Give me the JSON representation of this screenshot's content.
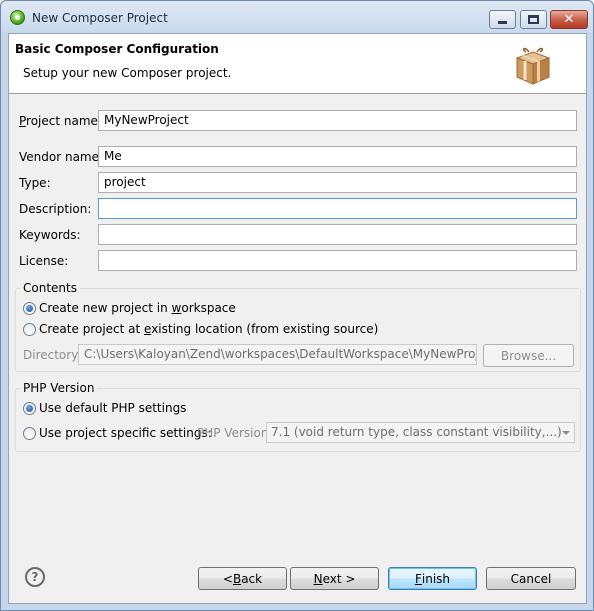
{
  "window": {
    "title": "New Composer Project",
    "min_glyph": "–",
    "max_glyph": "□",
    "close_glyph": "✕"
  },
  "banner": {
    "title": "Basic Composer Configuration",
    "subtitle": "Setup your new Composer project.",
    "icon": "package-icon"
  },
  "form": {
    "project_name": {
      "label_pre": "",
      "label_u": "P",
      "label_post": "roject name:",
      "value": "MyNewProject"
    },
    "vendor_name": {
      "label": "Vendor name:",
      "value": "Me"
    },
    "type": {
      "label": "Type:",
      "value": "project"
    },
    "description": {
      "label": "Description:",
      "value": ""
    },
    "keywords": {
      "label": "Keywords:",
      "value": ""
    },
    "license": {
      "label": "License:",
      "value": ""
    }
  },
  "contents": {
    "title": "Contents",
    "option_new_pre": "Create new project in ",
    "option_new_u": "w",
    "option_new_post": "orkspace",
    "option_existing_pre": "Create project at ",
    "option_existing_u": "e",
    "option_existing_post": "xisting location (from existing source)",
    "selected": "new",
    "directory_label": "Directory:",
    "directory_value": "C:\\Users\\Kaloyan\\Zend\\workspaces\\DefaultWorkspace\\MyNewProject",
    "browse_label": "Browse..."
  },
  "php_version": {
    "title": "PHP Version",
    "option_default": "Use default PHP settings",
    "option_specific": "Use project specific settings:",
    "selected": "default",
    "version_label": "PHP Version:",
    "version_value": "7.1 (void return type, class constant visibility,...)"
  },
  "footer": {
    "help_glyph": "?",
    "back_pre": "< ",
    "back_u": "B",
    "back_post": "ack",
    "next_u": "N",
    "next_post": "ext >",
    "finish_u": "F",
    "finish_post": "inish",
    "cancel": "Cancel"
  }
}
